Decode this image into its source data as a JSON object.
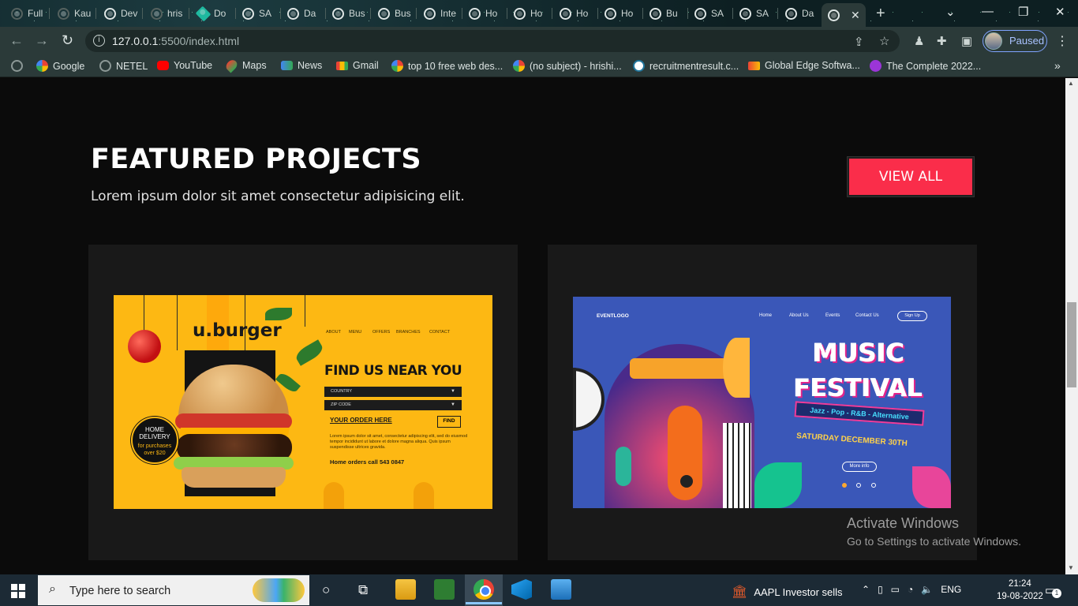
{
  "browser": {
    "tabs": [
      {
        "label": "Full",
        "icon": "github-icon"
      },
      {
        "label": "Kau",
        "icon": "github-icon"
      },
      {
        "label": "Dev",
        "icon": "globe-icon"
      },
      {
        "label": "hris",
        "icon": "github-icon"
      },
      {
        "label": "Do",
        "icon": "diamond-icon"
      },
      {
        "label": "SA",
        "icon": "globe-icon"
      },
      {
        "label": "Da",
        "icon": "globe-icon"
      },
      {
        "label": "Bus",
        "icon": "globe-icon"
      },
      {
        "label": "Bus",
        "icon": "globe-icon"
      },
      {
        "label": "Inte",
        "icon": "globe-icon"
      },
      {
        "label": "Ho",
        "icon": "globe-icon"
      },
      {
        "label": "Ho",
        "icon": "globe-icon"
      },
      {
        "label": "Ho",
        "icon": "globe-icon"
      },
      {
        "label": "Ho",
        "icon": "globe-icon"
      },
      {
        "label": "Bu",
        "icon": "globe-icon"
      },
      {
        "label": "SA",
        "icon": "globe-icon"
      },
      {
        "label": "SA",
        "icon": "globe-icon"
      },
      {
        "label": "Da",
        "icon": "globe-icon"
      }
    ],
    "new_tab_symbol": "+",
    "url_host": "127.0.0.1",
    "url_rest": ":5500/index.html",
    "profile_status": "Paused",
    "bookmarks": [
      {
        "label": "Google",
        "icon": "g"
      },
      {
        "label": "NETEL",
        "icon": "globe"
      },
      {
        "label": "YouTube",
        "icon": "yt"
      },
      {
        "label": "Maps",
        "icon": "maps"
      },
      {
        "label": "News",
        "icon": "news"
      },
      {
        "label": "Gmail",
        "icon": "gm"
      },
      {
        "label": "top 10 free web des...",
        "icon": "g"
      },
      {
        "label": "(no subject) - hrishi...",
        "icon": "g"
      },
      {
        "label": "recruitmentresult.c...",
        "icon": "wp"
      },
      {
        "label": "Global Edge Softwa...",
        "icon": "ge"
      },
      {
        "label": "The Complete 2022...",
        "icon": "pur"
      }
    ]
  },
  "section": {
    "title": "FEATURED PROJECTS",
    "subtitle": "Lorem ipsum dolor sit amet consectetur adipisicing elit.",
    "view_all_label": "VIEW ALL",
    "accent_color": "#fa2d4a"
  },
  "projects": {
    "burger": {
      "brand": "u.burger",
      "nav": [
        "ABOUT",
        "MENU",
        "OFFERS",
        "BRANCHES",
        "CONTACT"
      ],
      "heading": "FIND US NEAR YOU",
      "select_country": "COUNTRY",
      "select_zip": "ZIP CODE",
      "order_link": "YOUR ORDER HERE",
      "find_button": "FIND",
      "body": "Lorem ipsum dolor sit amet, consectetur adipiscing elit, sed do eiusmod tempor incididunt ut labore et dolore magna aliqua. Quis ipsum suspendisse ultrices gravida.",
      "phone": "Home orders call 543 0847",
      "badge_title": "HOME DELIVERY",
      "badge_sub": "for purchases over $20",
      "bg_color": "#fdb813"
    },
    "music": {
      "logo": "EVENTLOGO",
      "nav": [
        "Home",
        "About Us",
        "Events",
        "Contact Us"
      ],
      "signup": "Sign Up",
      "title_line1": "MUSIC",
      "title_line2": "FESTIVAL",
      "genres": "Jazz - Pop - R&B - Alternative",
      "date": "SATURDAY DECEMBER 30TH",
      "more": "More info",
      "bg_color": "#3a57b8"
    }
  },
  "activation": {
    "line1": "Activate Windows",
    "line2": "Go to Settings to activate Windows."
  },
  "taskbar": {
    "search_placeholder": "Type here to search",
    "stock_text": "AAPL  Investor sells",
    "language": "ENG",
    "time": "21:24",
    "date": "19-08-2022",
    "notification_count": "1"
  }
}
